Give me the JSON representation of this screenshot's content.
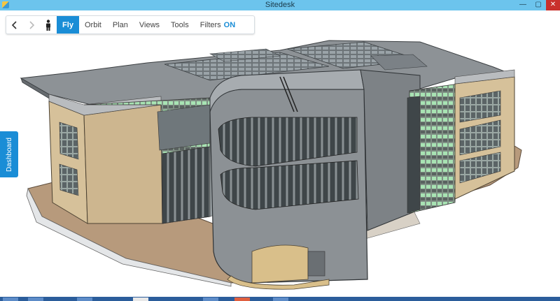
{
  "window": {
    "title": "Sitedesk",
    "controls": [
      "minimize",
      "maximize",
      "close"
    ]
  },
  "toolbar": {
    "back_icon": "chevron-left-icon",
    "forward_icon": "chevron-right-icon",
    "person_icon": "person-icon",
    "modes": [
      {
        "label": "Fly",
        "active": true
      },
      {
        "label": "Orbit",
        "active": false
      },
      {
        "label": "Plan",
        "active": false
      },
      {
        "label": "Views",
        "active": false
      },
      {
        "label": "Tools",
        "active": false
      }
    ],
    "filters_label": "Filters",
    "filters_state": "ON"
  },
  "sidebar": {
    "dashboard_label": "Dashboard"
  },
  "viewport": {
    "content": "3d-building-model",
    "accent": "#1a8dd6"
  },
  "colors": {
    "titlebar": "#6cc4ed",
    "accent": "#1a8dd6",
    "close": "#c9302c"
  }
}
